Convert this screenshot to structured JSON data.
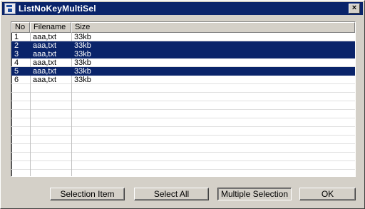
{
  "window": {
    "title": "ListNoKeyMultiSel",
    "close_label": "×"
  },
  "list": {
    "columns": [
      "No",
      "Filename",
      "Size"
    ],
    "rows": [
      {
        "no": "1",
        "filename": "aaa,txt",
        "size": "33kb",
        "selected": false
      },
      {
        "no": "2",
        "filename": "aaa,txt",
        "size": "33kb",
        "selected": true
      },
      {
        "no": "3",
        "filename": "aaa,txt",
        "size": "33kb",
        "selected": true
      },
      {
        "no": "4",
        "filename": "aaa,txt",
        "size": "33kb",
        "selected": false
      },
      {
        "no": "5",
        "filename": "aaa,txt",
        "size": "33kb",
        "selected": true
      },
      {
        "no": "6",
        "filename": "aaa,txt",
        "size": "33kb",
        "selected": false
      }
    ]
  },
  "buttons": {
    "selection_item": "Selection Item",
    "select_all": "Select All",
    "multiple_selection": "Multiple Selection",
    "ok": "OK"
  },
  "colors": {
    "selection": "#0a246a",
    "face": "#d4d0c8"
  }
}
